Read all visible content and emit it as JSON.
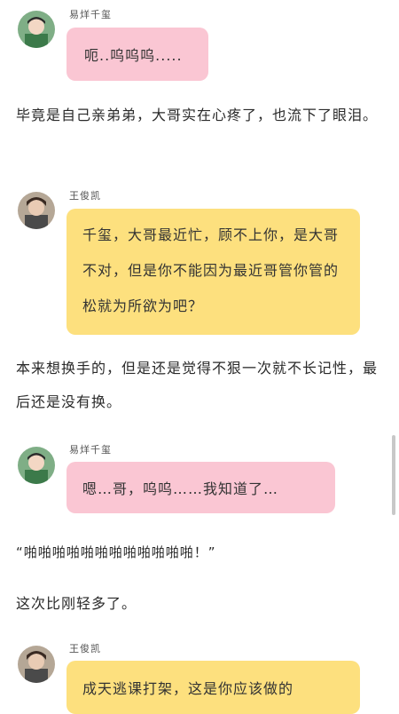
{
  "dialogue": [
    {
      "speaker": "易烊千玺",
      "text": "呃..呜呜呜....."
    },
    {
      "speaker": "王俊凯",
      "text": "千玺，大哥最近忙，顾不上你，是大哥不对，但是你不能因为最近哥管你管的松就为所欲为吧？"
    },
    {
      "speaker": "易烊千玺",
      "text": "嗯…哥，呜呜……我知道了…"
    },
    {
      "speaker": "王俊凯",
      "text": "成天逃课打架，这是你应该做的"
    }
  ],
  "narration": [
    "毕竟是自己亲弟弟，大哥实在心疼了，也流下了眼泪。",
    "本来想换手的，但是还是觉得不狠一次就不长记性，最后还是没有换。",
    "“啪啪啪啪啪啪啪啪啪啪啪啪！”",
    "这次比刚轻多了。"
  ],
  "colors": {
    "pink_bubble": "#fac6d3",
    "yellow_bubble": "#fde07e"
  }
}
